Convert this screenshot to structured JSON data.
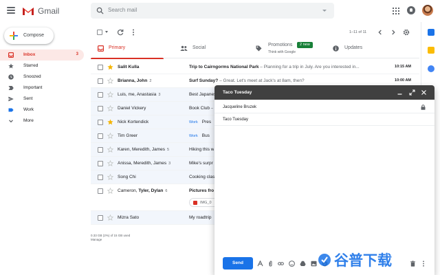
{
  "header": {
    "app_name": "Gmail",
    "search_placeholder": "Search mail",
    "colors": {
      "brand_red": "#d93025",
      "accent_blue": "#1a73e8"
    }
  },
  "compose_button": {
    "label": "Compose"
  },
  "nav": [
    {
      "label": "Inbox",
      "icon": "inbox-icon",
      "count": "3",
      "active": true
    },
    {
      "label": "Starred",
      "icon": "star-icon"
    },
    {
      "label": "Snoozed",
      "icon": "clock-icon"
    },
    {
      "label": "Important",
      "icon": "important-icon"
    },
    {
      "label": "Sent",
      "icon": "send-icon"
    },
    {
      "label": "Work",
      "icon": "label-icon"
    },
    {
      "label": "More",
      "icon": "chevron-down-icon"
    }
  ],
  "toolbar": {
    "page_count": "1–11 of 11"
  },
  "tabs": [
    {
      "label": "Primary",
      "icon": "inbox-icon",
      "active": true
    },
    {
      "label": "Social",
      "icon": "people-icon"
    },
    {
      "label": "Promotions",
      "icon": "tag-icon",
      "badge": "2 new",
      "subtitle": "Think with Google"
    },
    {
      "label": "Updates",
      "icon": "info-icon"
    }
  ],
  "emails": [
    {
      "sender": "Salit Kulla",
      "count": "",
      "subject": "Trip to Cairngorms National Park",
      "snippet": " – Planning for a trip in July. Are you interested in...",
      "date": "10:15 AM",
      "unread": true,
      "starred": true
    },
    {
      "sender": "Brianna, John",
      "count": "2",
      "subject": "Surf Sunday?",
      "snippet": " – Great. Let's meet at Jack's at 8am, then?",
      "date": "10:00 AM",
      "unread": true,
      "starred": false
    },
    {
      "sender": "Luis, me, Anastasia",
      "count": "3",
      "subject": "Best Japanese",
      "snippet": "",
      "date": "",
      "unread": false,
      "starred": false
    },
    {
      "sender": "Daniel Vickery",
      "count": "",
      "subject": "Book Club",
      "snippet": " –",
      "date": "",
      "unread": false,
      "starred": false
    },
    {
      "sender": "Nick Kortendick",
      "count": "",
      "label": "Work",
      "subject": "Pres",
      "snippet": "",
      "date": "",
      "unread": false,
      "starred": true
    },
    {
      "sender": "Tim Greer",
      "count": "",
      "label": "Work",
      "subject": "Bus",
      "snippet": "",
      "date": "",
      "unread": false,
      "starred": false
    },
    {
      "sender": "Karen, Meredith, James",
      "count": "5",
      "subject": "Hiking this w",
      "snippet": "",
      "date": "",
      "unread": false,
      "starred": false
    },
    {
      "sender": "Anissa, Meredith, James",
      "count": "3",
      "subject": "Mike's surpr",
      "snippet": "",
      "date": "",
      "unread": false,
      "starred": false
    },
    {
      "sender": "Song Chi",
      "count": "",
      "subject": "Cooking clas",
      "snippet": "",
      "date": "",
      "unread": false,
      "starred": false
    },
    {
      "sender_plain": "Cameron, ",
      "sender_bold": "Tyler, Dylan",
      "count": "6",
      "subject": "Pictures fro",
      "snippet": "",
      "date": "",
      "unread": true,
      "starred": false,
      "attachment": "IMG_0"
    },
    {
      "sender": "Mizra Sato",
      "count": "",
      "subject": "My roadtrip",
      "snippet": "",
      "date": "",
      "unread": false,
      "starred": false
    }
  ],
  "storage": {
    "usage": "0.33 GB (2%) of 15 GB used",
    "manage": "Manage"
  },
  "compose_window": {
    "title": "Taco Tuesday",
    "to": "Jacqueline Bruzek",
    "subject": "Taco Tuesday",
    "send_label": "Send"
  },
  "watermark": {
    "text": "谷普下载"
  }
}
